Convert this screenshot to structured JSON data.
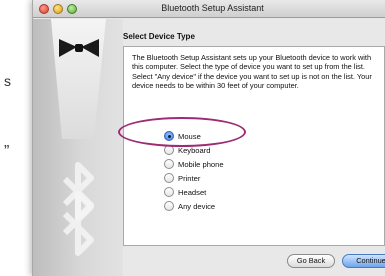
{
  "background": {
    "left_fragment_1": "s",
    "left_fragment_2": "”"
  },
  "window": {
    "title": "Bluetooth Setup Assistant",
    "traffic_lights": [
      "close",
      "minimize",
      "zoom"
    ]
  },
  "page": {
    "heading": "Select Device Type",
    "description": "The Bluetooth Setup Assistant sets up your Bluetooth device to work with this computer. Select the type of device you want to set up from the list. Select \"Any device\" if the device you want to set up is not on the list. Your device needs to be within 30 feet of your computer."
  },
  "device_types": [
    {
      "label": "Mouse",
      "selected": true
    },
    {
      "label": "Keyboard",
      "selected": false
    },
    {
      "label": "Mobile phone",
      "selected": false
    },
    {
      "label": "Printer",
      "selected": false
    },
    {
      "label": "Headset",
      "selected": false
    },
    {
      "label": "Any device",
      "selected": false
    }
  ],
  "buttons": {
    "back": "Go Back",
    "continue": "Continue"
  },
  "colors": {
    "highlight": "#9c2b73",
    "accent": "#3979d8"
  }
}
